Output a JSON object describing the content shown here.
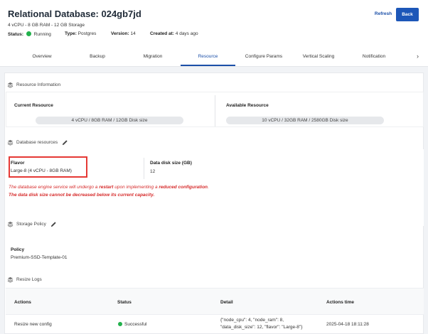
{
  "header": {
    "title": "Relational Database: 024gb7jd",
    "subtitle": "4 vCPU - 8 GB RAM - 12 GB Storage",
    "status_label": "Status:",
    "status_value": "Running",
    "type_label": "Type:",
    "type_value": "Postgres",
    "version_label": "Version:",
    "version_value": "14",
    "created_label": "Created at:",
    "created_value": "4 days ago",
    "refresh_label": "Refresh",
    "back_label": "Back"
  },
  "tabs": [
    {
      "label": "Overview"
    },
    {
      "label": "Backup"
    },
    {
      "label": "Migration"
    },
    {
      "label": "Resource",
      "active": true
    },
    {
      "label": "Configure Params"
    },
    {
      "label": "Vertical Scaling"
    },
    {
      "label": "Notification"
    }
  ],
  "resource_info": {
    "heading": "Resource Information",
    "current_label": "Current Resource",
    "current_value": "4 vCPU / 8GB RAM / 12GB Disk size",
    "available_label": "Available Resource",
    "available_value": "10 vCPU / 32GB RAM / 2580GB Disk size"
  },
  "db_resources": {
    "heading": "Database resources",
    "flavor_label": "Flavor",
    "flavor_value": "Large-8 (4 vCPU - 8GB RAM)",
    "disk_label": "Data disk size (GB)",
    "disk_value": "12",
    "warning_1_pre": "The database engine service will undergo a ",
    "warning_1_restart": "restart",
    "warning_1_mid": " upon implementing a ",
    "warning_1_reduced": "reduced configuration",
    "warning_1_end": ".",
    "warning_2": "The data disk size cannot be decreased below its current capacity."
  },
  "storage_policy": {
    "heading": "Storage Policy",
    "policy_label": "Policy",
    "policy_value": "Premium-SSD-Template-01"
  },
  "resize_logs": {
    "heading": "Resize Logs",
    "columns": [
      "Actions",
      "Status",
      "Detail",
      "Actions time"
    ],
    "rows": [
      {
        "action": "Resize new config",
        "status": "Successful",
        "detail_line1": "{\"node_cpu\": 4, \"node_ram\": 8,",
        "detail_line2": "\"data_disk_size\": 12, \"flavor\": \"Large-8\"}",
        "time": "2025-04-18 18:11:28"
      }
    ]
  },
  "colors": {
    "accent": "#1b4fa8",
    "primary_button": "#1d57b8",
    "status_green": "#22b14c",
    "warning_red": "#d62b2b",
    "highlight_red": "#e53935"
  }
}
